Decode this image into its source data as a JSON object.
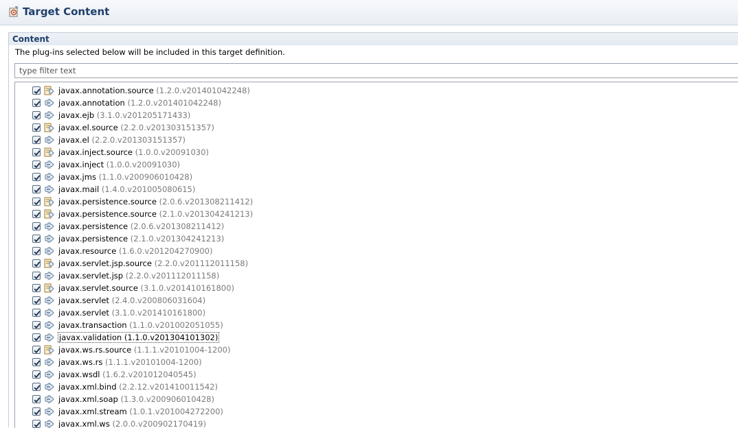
{
  "header": {
    "title": "Target Content",
    "icon": "target-definition-icon"
  },
  "section": {
    "title": "Content",
    "description": "The plug-ins selected below will be included in this target definition.",
    "filter_placeholder": "type filter text"
  },
  "plugins": [
    {
      "name": "javax.annotation.source",
      "version": "(1.2.0.v201401042248)",
      "source": true,
      "checked": true
    },
    {
      "name": "javax.annotation",
      "version": "(1.2.0.v201401042248)",
      "source": false,
      "checked": true
    },
    {
      "name": "javax.ejb",
      "version": "(3.1.0.v201205171433)",
      "source": false,
      "checked": true
    },
    {
      "name": "javax.el.source",
      "version": "(2.2.0.v201303151357)",
      "source": true,
      "checked": true
    },
    {
      "name": "javax.el",
      "version": "(2.2.0.v201303151357)",
      "source": false,
      "checked": true
    },
    {
      "name": "javax.inject.source",
      "version": "(1.0.0.v20091030)",
      "source": true,
      "checked": true
    },
    {
      "name": "javax.inject",
      "version": "(1.0.0.v20091030)",
      "source": false,
      "checked": true
    },
    {
      "name": "javax.jms",
      "version": "(1.1.0.v200906010428)",
      "source": false,
      "checked": true
    },
    {
      "name": "javax.mail",
      "version": "(1.4.0.v201005080615)",
      "source": false,
      "checked": true
    },
    {
      "name": "javax.persistence.source",
      "version": "(2.0.6.v201308211412)",
      "source": true,
      "checked": true
    },
    {
      "name": "javax.persistence.source",
      "version": "(2.1.0.v201304241213)",
      "source": true,
      "checked": true
    },
    {
      "name": "javax.persistence",
      "version": "(2.0.6.v201308211412)",
      "source": false,
      "checked": true
    },
    {
      "name": "javax.persistence",
      "version": "(2.1.0.v201304241213)",
      "source": false,
      "checked": true
    },
    {
      "name": "javax.resource",
      "version": "(1.6.0.v201204270900)",
      "source": false,
      "checked": true
    },
    {
      "name": "javax.servlet.jsp.source",
      "version": "(2.2.0.v201112011158)",
      "source": true,
      "checked": true
    },
    {
      "name": "javax.servlet.jsp",
      "version": "(2.2.0.v201112011158)",
      "source": false,
      "checked": true
    },
    {
      "name": "javax.servlet.source",
      "version": "(3.1.0.v201410161800)",
      "source": true,
      "checked": true
    },
    {
      "name": "javax.servlet",
      "version": "(2.4.0.v200806031604)",
      "source": false,
      "checked": true
    },
    {
      "name": "javax.servlet",
      "version": "(3.1.0.v201410161800)",
      "source": false,
      "checked": true
    },
    {
      "name": "javax.transaction",
      "version": "(1.1.0.v201002051055)",
      "source": false,
      "checked": true
    },
    {
      "name": "javax.validation",
      "version": "(1.1.0.v201304101302)",
      "source": false,
      "checked": true,
      "selected": true
    },
    {
      "name": "javax.ws.rs.source",
      "version": "(1.1.1.v20101004-1200)",
      "source": true,
      "checked": true
    },
    {
      "name": "javax.ws.rs",
      "version": "(1.1.1.v20101004-1200)",
      "source": false,
      "checked": true
    },
    {
      "name": "javax.wsdl",
      "version": "(1.6.2.v201012040545)",
      "source": false,
      "checked": true
    },
    {
      "name": "javax.xml.bind",
      "version": "(2.2.12.v201410011542)",
      "source": false,
      "checked": true
    },
    {
      "name": "javax.xml.soap",
      "version": "(1.3.0.v200906010428)",
      "source": false,
      "checked": true
    },
    {
      "name": "javax.xml.stream",
      "version": "(1.0.1.v201004272200)",
      "source": false,
      "checked": true
    },
    {
      "name": "javax.xml.ws",
      "version": "(2.0.0.v200902170419)",
      "source": false,
      "checked": true
    }
  ]
}
